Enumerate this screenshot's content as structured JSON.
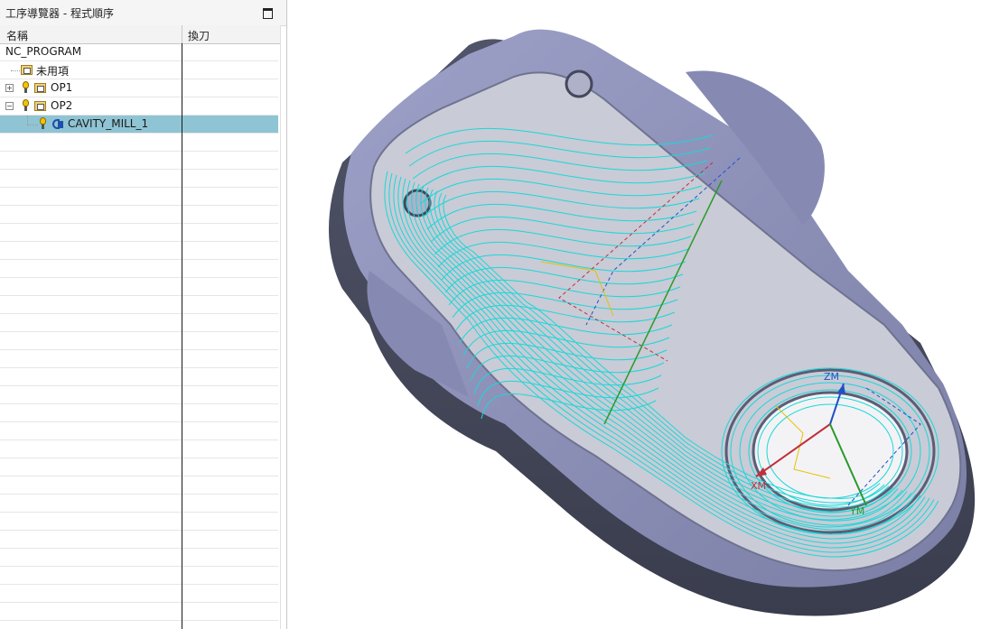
{
  "navigator": {
    "title": "工序導覽器 - 程式順序",
    "columns": {
      "name": "名稱",
      "tool_change": "換刀"
    },
    "tree": {
      "root": "NC_PROGRAM",
      "unused": "未用項",
      "op1": "OP1",
      "op2": "OP2",
      "operation": "CAVITY_MILL_1"
    },
    "selected_item": "CAVITY_MILL_1"
  },
  "viewport": {
    "axis_labels": {
      "z": "ZM",
      "x": "XM",
      "y": "YM"
    },
    "colors": {
      "toolpath": "#19d8d8",
      "part": "#8a8fb8",
      "selection": "#8fc4d4",
      "axis_x": "#c0303a",
      "axis_y": "#2a9a2a",
      "axis_z": "#2050c8"
    }
  }
}
